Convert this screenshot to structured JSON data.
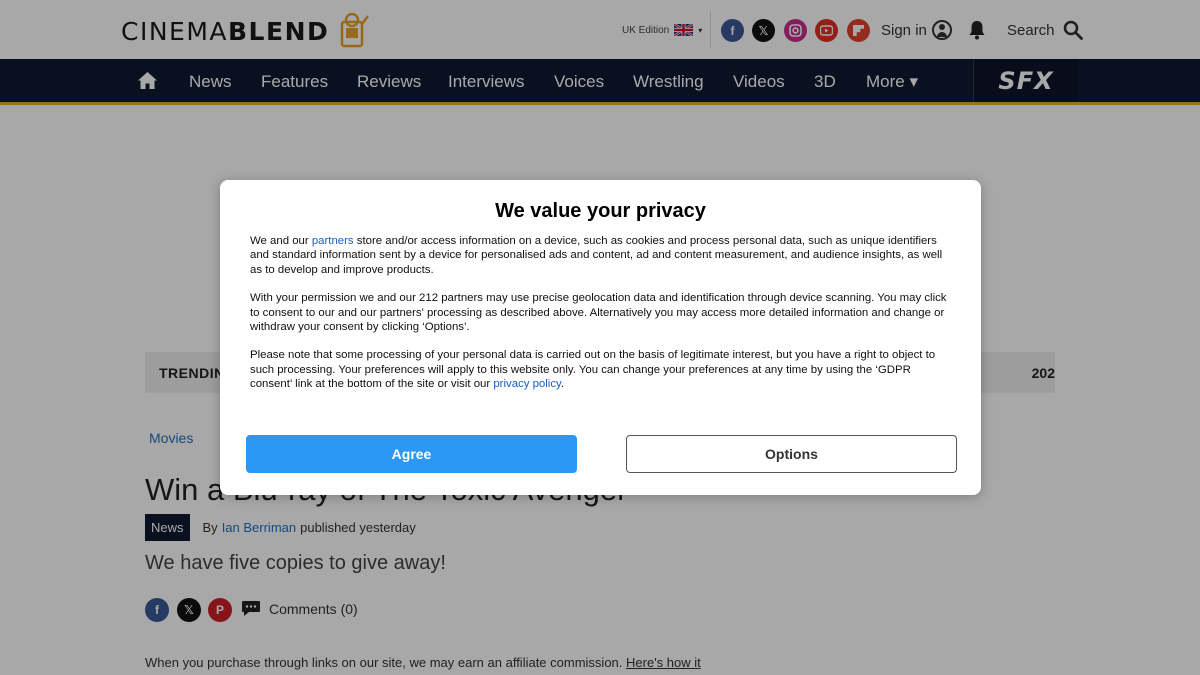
{
  "header": {
    "logo_part1": "CINEMA",
    "logo_part2": "BLEND",
    "edition": "UK Edition",
    "sign_in": "Sign in",
    "search": "Search",
    "social_icons": [
      "facebook-icon",
      "x-icon",
      "instagram-icon",
      "youtube-icon",
      "flipboard-icon"
    ]
  },
  "nav": {
    "items": [
      "News",
      "Features",
      "Reviews",
      "Interviews",
      "Voices",
      "Wrestling",
      "Videos",
      "3D",
      "More ▾"
    ],
    "sfx": "SFX"
  },
  "trending": {
    "label": "TRENDIN",
    "tail": "202"
  },
  "article": {
    "breadcrumb": "Movies",
    "headline": "Win a Blu-ray of The Toxic Avenger",
    "tag": "News",
    "by": "By",
    "author": "Ian Berriman",
    "published": "published yesterday",
    "strapline": "We have five copies to give away!",
    "comments": "Comments (0)",
    "affiliate_text": "When you purchase through links on our site, we may earn an affiliate commission.",
    "affiliate_link": "Here's how it"
  },
  "consent": {
    "title": "We value your privacy",
    "p1_a": "We and our ",
    "p1_link": "partners",
    "p1_b": " store and/or access information on a device, such as cookies and process personal data, such as unique identifiers and standard information sent by a device for personalised ads and content, ad and content measurement, and audience insights, as well as to develop and improve products.",
    "p2": "With your permission we and our 212 partners may use precise geolocation data and identification through device scanning. You may click to consent to our and our partners' processing as described above. Alternatively you may access more detailed information and change or withdraw your consent by clicking ‘Options’.",
    "p3_a": "Please note that some processing of your personal data is carried out on the basis of legitimate interest, but you have a right to object to such processing. Your preferences will apply to this website only. You can change your preferences at any time by using the ‘GDPR consent’ link at the bottom of the site or visit our ",
    "p3_link": "privacy policy",
    "p3_b": ".",
    "agree": "Agree",
    "options": "Options"
  },
  "colors": {
    "nav_bg": "#0e1a33",
    "nav_accent": "#ecab2c",
    "agree_button": "#2b98f5",
    "link": "#1f6fc4"
  }
}
